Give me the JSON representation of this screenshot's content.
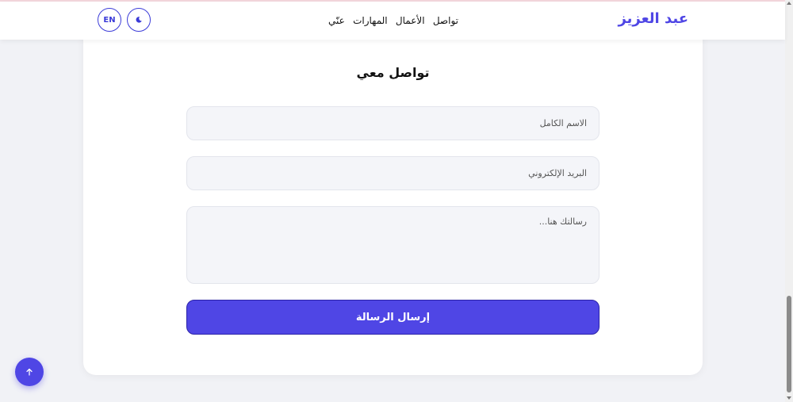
{
  "header": {
    "brand": "عبد العزيز",
    "nav": [
      "عنّي",
      "المهارات",
      "الأعمال",
      "تواصل"
    ],
    "lang_toggle": "EN",
    "theme_icon": "moon-icon"
  },
  "contact": {
    "title": "تواصل معي",
    "name_placeholder": "الاسم الكامل",
    "email_placeholder": "البريد الإلكتروني",
    "message_placeholder": "رسالتك هنا...",
    "submit_label": "إرسال الرسالة"
  },
  "back_to_top_icon": "arrow-up-icon",
  "colors": {
    "accent": "#4f46e5",
    "background": "#f1f2f6",
    "field_background": "#f4f5f9"
  }
}
